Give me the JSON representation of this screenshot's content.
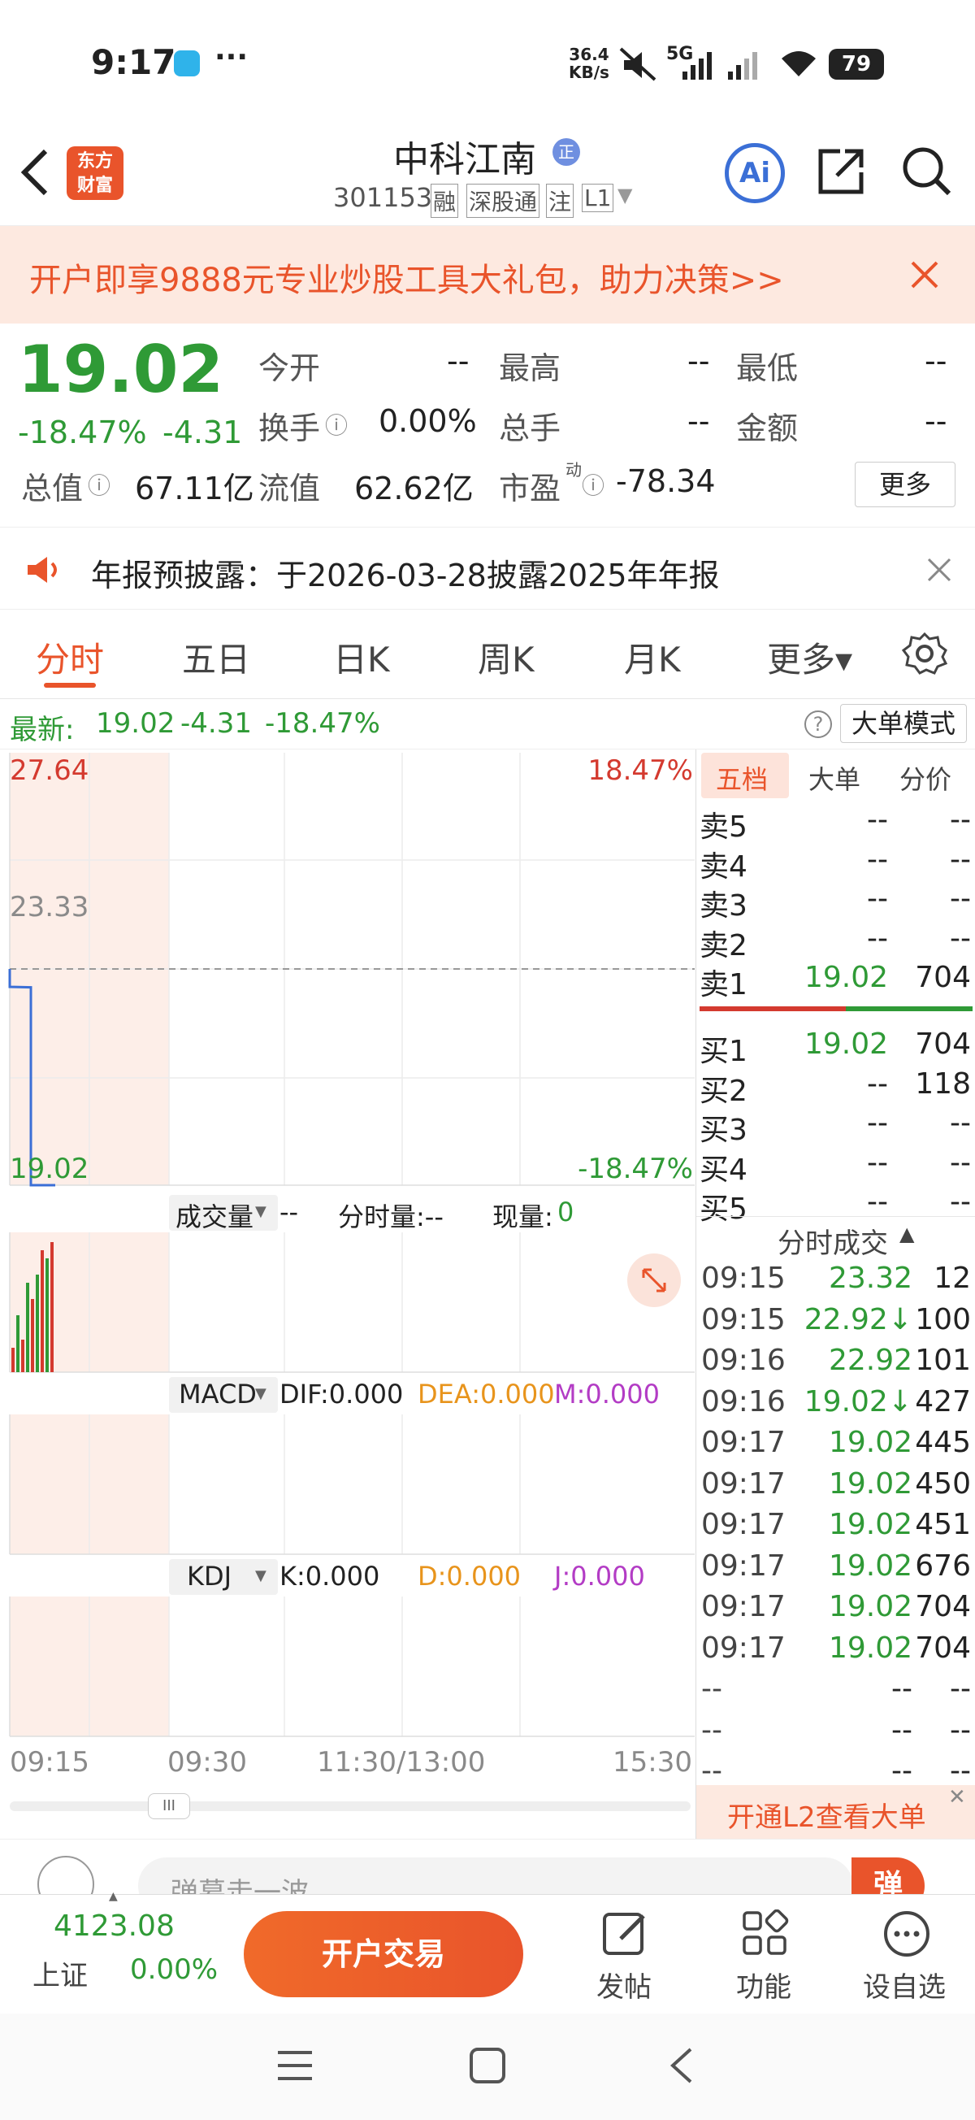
{
  "status_bar": {
    "time": "9:17",
    "net_speed_top": "36.4",
    "net_speed_bottom": "KB/s",
    "network": "5G",
    "battery": "79"
  },
  "header": {
    "back_label": "<",
    "logo_line1": "东方",
    "logo_line2": "财富",
    "stock_name": "中科江南",
    "name_badge": "正",
    "stock_code": "301153",
    "tags": [
      "融",
      "深股通",
      "注",
      "L1"
    ],
    "ai_label": "Ai"
  },
  "banner": {
    "text": "开户即享9888元专业炒股工具大礼包，助力决策>>"
  },
  "quote": {
    "price": "19.02",
    "change_pct": "-18.47%",
    "change": "-4.31",
    "open_label": "今开",
    "open_value": "--",
    "high_label": "最高",
    "high_value": "--",
    "low_label": "最低",
    "low_value": "--",
    "turnover_label": "换手",
    "turnover_value": "0.00%",
    "total_hands_label": "总手",
    "total_hands_value": "--",
    "amount_label": "金额",
    "amount_value": "--",
    "market_cap_label": "总值",
    "market_cap_value": "67.11亿",
    "float_cap_label": "流值",
    "float_cap_value": "62.62亿",
    "pe_label": "市盈",
    "pe_sup": "动",
    "pe_value": "-78.34",
    "more_button": "更多"
  },
  "notice": {
    "text": "年报预披露：于2026-03-28披露2025年年报"
  },
  "tabs": [
    {
      "label": "分时",
      "active": true
    },
    {
      "label": "五日"
    },
    {
      "label": "日K"
    },
    {
      "label": "周K"
    },
    {
      "label": "月K"
    },
    {
      "label": "更多▾"
    }
  ],
  "latest_line": {
    "label": "最新:",
    "price": "19.02",
    "change": "-4.31",
    "pct": "-18.47%",
    "mode_button": "大单模式"
  },
  "chart": {
    "price_top": "27.64",
    "pct_top": "18.47%",
    "price_mid": "23.33",
    "price_bottom": "19.02",
    "pct_bottom": "-18.47%",
    "volume_label": "成交量",
    "volume_value": "--",
    "tick_volume_label": "分时量:--",
    "current_volume_label": "现量:",
    "current_volume_value": "0",
    "macd_label": "MACD",
    "dif": "DIF:0.000",
    "dea": "DEA:0.000",
    "m": "M:0.000",
    "kdj_label": "KDJ",
    "k": "K:0.000",
    "d": "D:0.000",
    "j": "J:0.000",
    "x_ticks": [
      "09:15",
      "09:30",
      "11:30/13:00",
      "15:30"
    ],
    "scroll_handle": "III"
  },
  "chart_data": {
    "type": "line",
    "x": [
      "09:15",
      "09:16",
      "09:17"
    ],
    "series": [
      {
        "values": [
          23.33,
          23.32,
          19.02
        ]
      }
    ],
    "ylim": [
      19.02,
      27.64
    ],
    "reference_price": 23.33
  },
  "orderbook": {
    "tabs": [
      "五档",
      "大单",
      "分价"
    ],
    "asks": [
      {
        "label": "卖5",
        "price": "--",
        "vol": "--"
      },
      {
        "label": "卖4",
        "price": "--",
        "vol": "--"
      },
      {
        "label": "卖3",
        "price": "--",
        "vol": "--"
      },
      {
        "label": "卖2",
        "price": "--",
        "vol": "--"
      },
      {
        "label": "卖1",
        "price": "19.02",
        "vol": "704"
      }
    ],
    "bids": [
      {
        "label": "买1",
        "price": "19.02",
        "vol": "704"
      },
      {
        "label": "买2",
        "price": "--",
        "vol": "118"
      },
      {
        "label": "买3",
        "price": "--",
        "vol": "--"
      },
      {
        "label": "买4",
        "price": "--",
        "vol": "--"
      },
      {
        "label": "买5",
        "price": "--",
        "vol": "--"
      }
    ],
    "trades_header": "分时成交",
    "trades": [
      {
        "time": "09:15",
        "price": "23.32",
        "vol": "12"
      },
      {
        "time": "09:15",
        "price": "22.92↓",
        "vol": "100"
      },
      {
        "time": "09:16",
        "price": "22.92",
        "vol": "101"
      },
      {
        "time": "09:16",
        "price": "19.02↓",
        "vol": "427"
      },
      {
        "time": "09:17",
        "price": "19.02",
        "vol": "445"
      },
      {
        "time": "09:17",
        "price": "19.02",
        "vol": "450"
      },
      {
        "time": "09:17",
        "price": "19.02",
        "vol": "451"
      },
      {
        "time": "09:17",
        "price": "19.02",
        "vol": "676"
      },
      {
        "time": "09:17",
        "price": "19.02",
        "vol": "704"
      },
      {
        "time": "09:17",
        "price": "19.02",
        "vol": "704"
      },
      {
        "time": "--",
        "price": "--",
        "vol": "--"
      },
      {
        "time": "--",
        "price": "--",
        "vol": "--"
      },
      {
        "time": "--",
        "price": "--",
        "vol": "--"
      }
    ],
    "l2_promo": "开通L2查看大单"
  },
  "comment_bar": {
    "placeholder": "弹幕走一波",
    "danmu_button": "弹"
  },
  "bottom": {
    "index_value": "4123.08",
    "index_name": "上证",
    "index_pct": "0.00%",
    "trade_button": "开户交易",
    "post_label": "发帖",
    "function_label": "功能",
    "watchlist_label": "设自选"
  },
  "colors": {
    "red": "#d43a2f",
    "green": "#2f9a36",
    "orange": "#e9542b",
    "accent_blue": "#3b6fd6"
  }
}
